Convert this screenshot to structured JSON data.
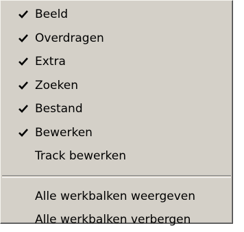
{
  "menu": {
    "items": [
      {
        "label": "Beeld",
        "checked": true
      },
      {
        "label": "Overdragen",
        "checked": true
      },
      {
        "label": "Extra",
        "checked": true
      },
      {
        "label": "Zoeken",
        "checked": true
      },
      {
        "label": "Bestand",
        "checked": true
      },
      {
        "label": "Bewerken",
        "checked": true
      },
      {
        "label": "Track bewerken",
        "checked": false
      }
    ],
    "actions": [
      {
        "label": "Alle werkbalken weergeven"
      },
      {
        "label": "Alle werkbalken verbergen"
      }
    ],
    "check_icon": "checkmark-icon"
  }
}
